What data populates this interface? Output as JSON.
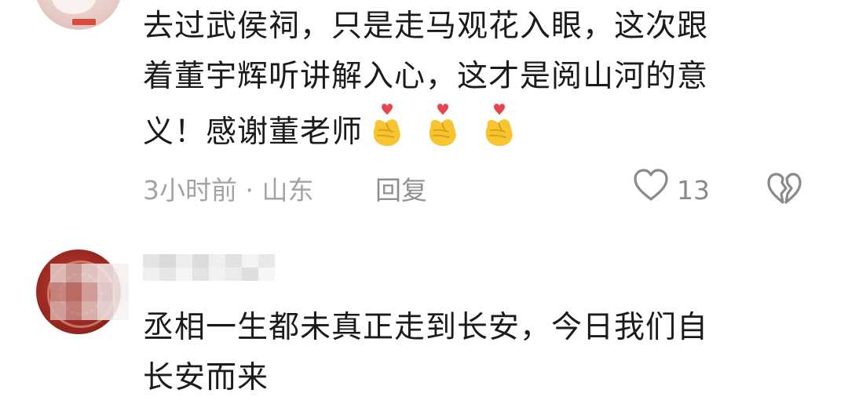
{
  "comments": [
    {
      "text_lines": [
        "去过武侯祠，只是走马观花入眼，这次跟",
        "着董宇辉听讲解入心，这才是阅山河的意",
        "义！感谢董老师"
      ],
      "emojis": [
        "heart-hands-emoji",
        "heart-hands-emoji",
        "heart-hands-emoji"
      ],
      "time_location": "3小时前 · 山东",
      "reply_label": "回复",
      "like_count": "13"
    },
    {
      "text_lines": [
        "丞相一生都未真正走到长安，今日我们自",
        "长安而来"
      ]
    }
  ],
  "colors": {
    "text_primary": "#1b1b1b",
    "text_meta": "#a3a3a3",
    "icon_gray": "#8a8a8a",
    "emoji_yellow": "#f7c531",
    "emoji_heart": "#e8464f"
  }
}
